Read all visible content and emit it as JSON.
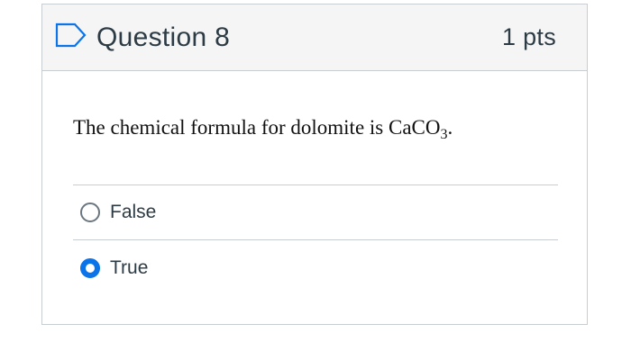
{
  "question": {
    "title": "Question 8",
    "points": "1 pts",
    "text_main": "The chemical formula for dolomite is CaCO",
    "text_subscript": "3",
    "text_end": ".",
    "flag_icon": "flag-outline-icon",
    "answers": [
      {
        "label": "False",
        "selected": false
      },
      {
        "label": "True",
        "selected": true
      }
    ]
  },
  "colors": {
    "header_background": "#f5f5f5",
    "border": "#c7cdd1",
    "text": "#2d3b45",
    "radio_selected": "#0a74e8",
    "flag_icon": "#0a74e8"
  }
}
